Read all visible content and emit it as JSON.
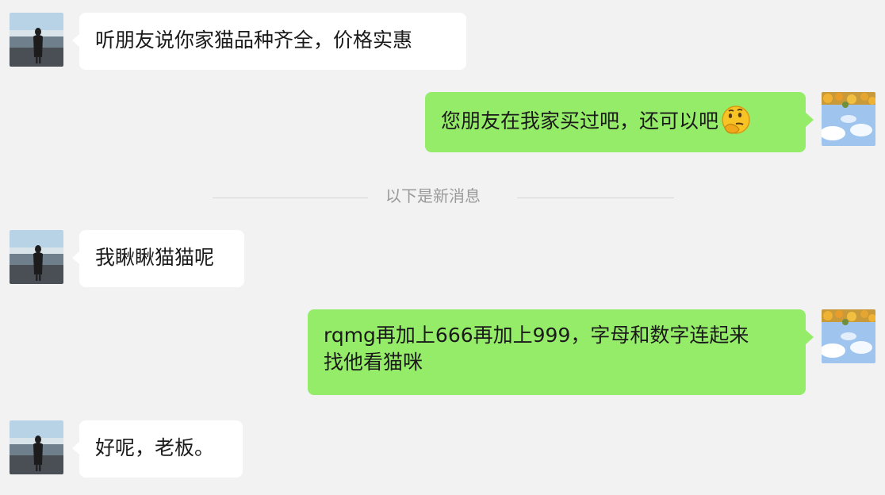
{
  "messages": [
    {
      "side": "left",
      "text": "听朋友说你家猫品种齐全，价格实惠",
      "avatar_icon": "person-on-beach-avatar-icon"
    },
    {
      "side": "right",
      "text": "您朋友在我家买过吧，还可以吧",
      "emoji": "thinking-face-icon",
      "avatar_icon": "flowers-sky-avatar-icon"
    },
    {
      "side": "left",
      "text": "我瞅瞅猫猫呢",
      "avatar_icon": "person-on-beach-avatar-icon"
    },
    {
      "side": "right",
      "line1": "rqmg再加上666再加上999，字母和数字连起来",
      "line2": "找他看猫咪",
      "avatar_icon": "flowers-sky-avatar-icon"
    },
    {
      "side": "left",
      "text": "好呢，老板。",
      "avatar_icon": "person-on-beach-avatar-icon"
    }
  ],
  "divider": {
    "text": "以下是新消息"
  },
  "colors": {
    "background": "#f2f2f2",
    "incoming_bubble": "#ffffff",
    "outgoing_bubble": "#95ec69",
    "divider_text": "#9a9a9a"
  }
}
